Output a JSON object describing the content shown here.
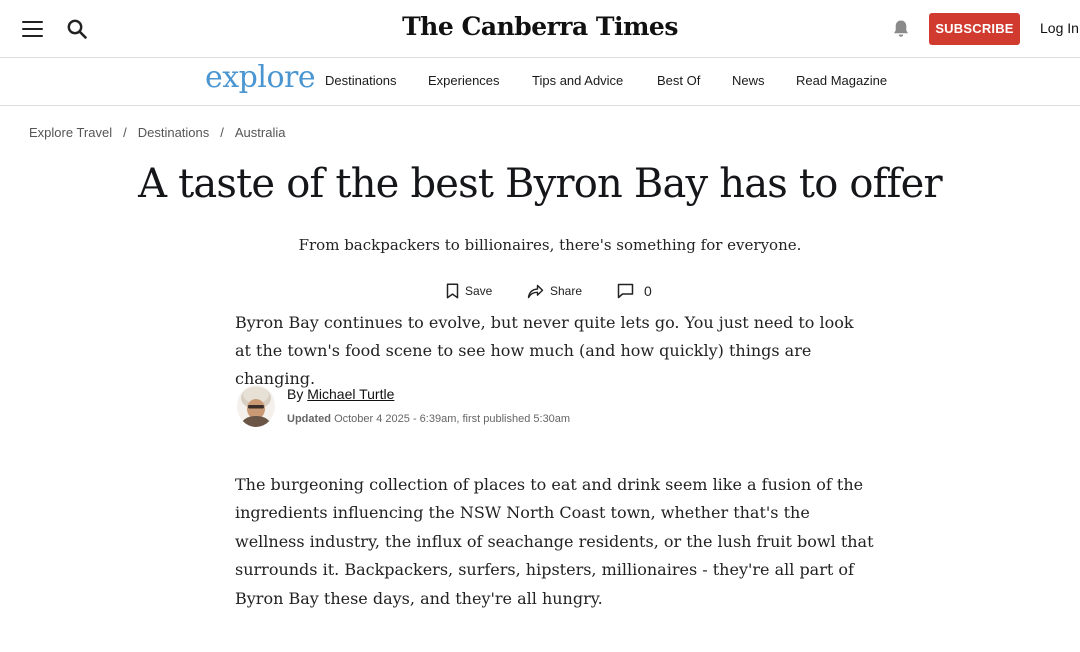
{
  "header": {
    "masthead": "The Canberra Times",
    "subscribe_label": "SUBSCRIBE",
    "login_label": "Log In",
    "brand_color": "#d13a2f"
  },
  "subnav": {
    "logo": "explore",
    "logo_color": "#4b96d1",
    "items": [
      {
        "label": "Destinations"
      },
      {
        "label": "Experiences"
      },
      {
        "label": "Tips and Advice"
      },
      {
        "label": "Best Of"
      },
      {
        "label": "News"
      },
      {
        "label": "Read Magazine"
      }
    ]
  },
  "breadcrumb": [
    "Explore Travel",
    "Destinations",
    "Australia"
  ],
  "article": {
    "headline": "A taste of the best Byron Bay has to offer",
    "standfirst": "From backpackers to billionaires, there's something for everyone.",
    "actions": {
      "save_label": "Save",
      "share_label": "Share",
      "comment_count": "0"
    },
    "lede": "Byron Bay continues to evolve, but never quite lets go. You just need to look at the town's food scene to see how much (and how quickly) things are changing.",
    "byline": {
      "prefix": "By",
      "author": "Michael Turtle",
      "updated_label": "Updated",
      "updated_text": "October 4 2025 - 6:39am, first published 5:30am"
    },
    "body": "The burgeoning collection of places to eat and drink seem like a fusion of the ingredients influencing the NSW North Coast town, whether that's the wellness industry, the influx of seachange residents, or the lush fruit bowl that surrounds it. Backpackers, surfers, hipsters, millionaires - they're all part of Byron Bay these days, and they're all hungry."
  }
}
